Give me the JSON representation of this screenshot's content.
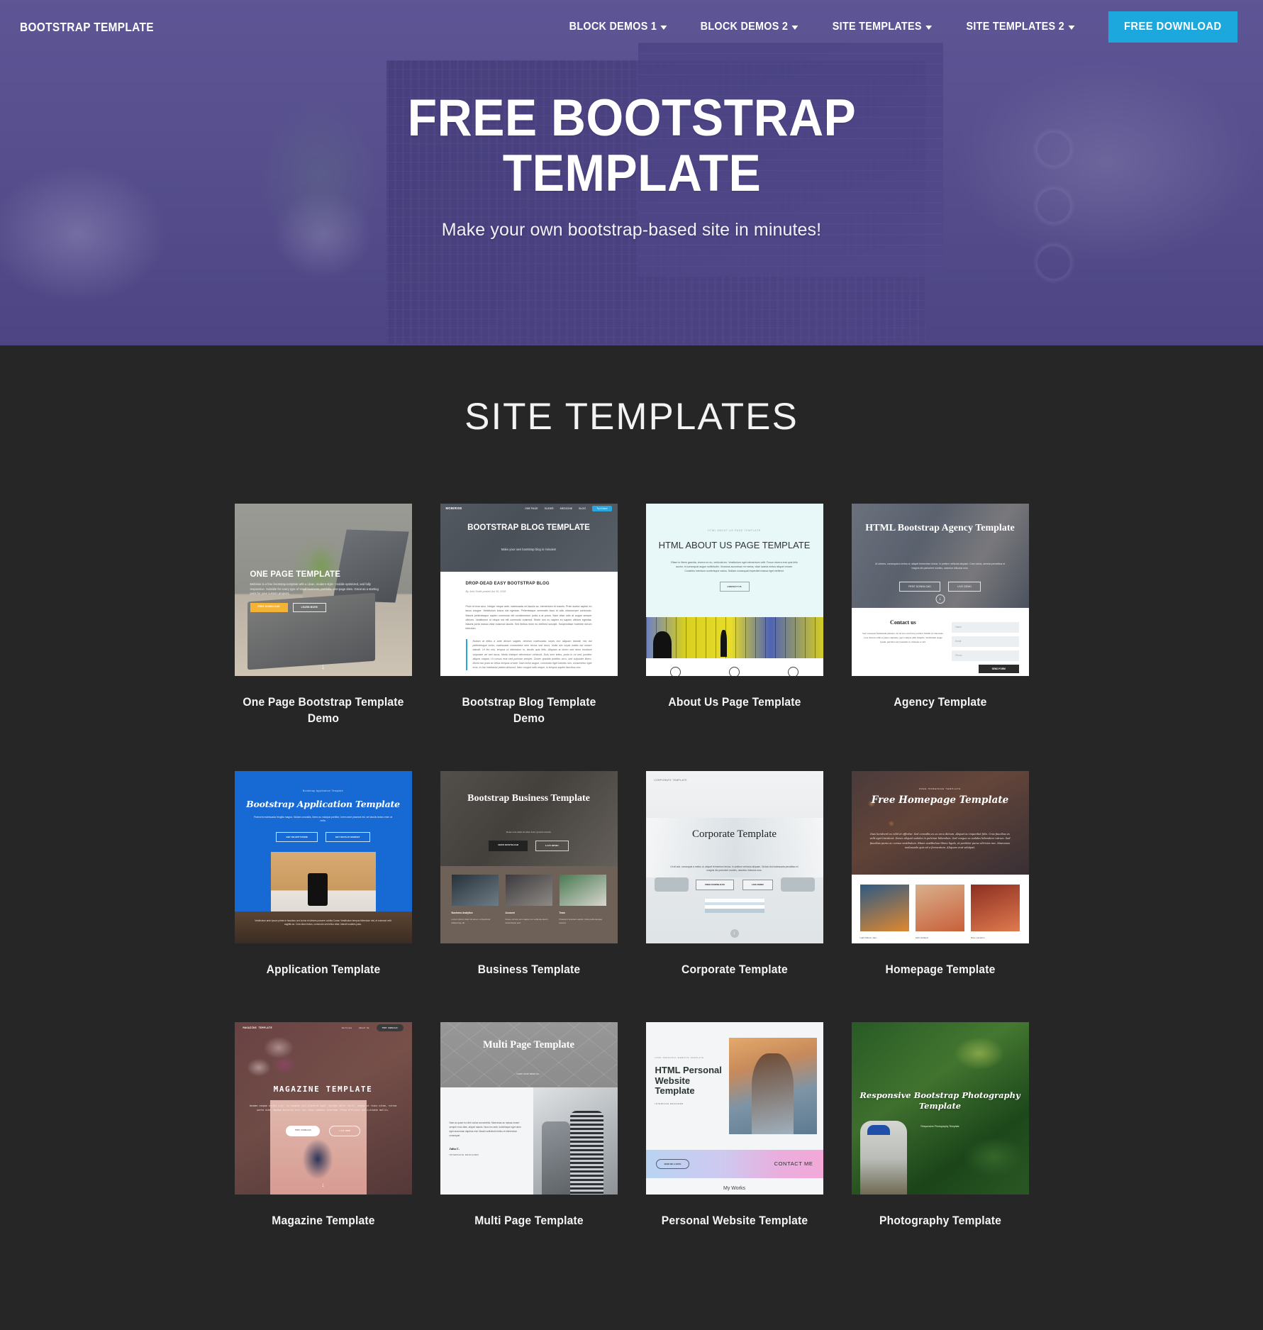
{
  "navbar": {
    "brand": "BOOTSTRAP TEMPLATE",
    "items": [
      {
        "label": "BLOCK DEMOS 1"
      },
      {
        "label": "BLOCK DEMOS 2"
      },
      {
        "label": "SITE TEMPLATES"
      },
      {
        "label": "SITE TEMPLATES 2"
      }
    ],
    "cta": "FREE DOWNLOAD",
    "cta_color": "#1ca8dd"
  },
  "hero": {
    "title": "FREE BOOTSTRAP TEMPLATE",
    "subtitle": "Make your own bootstrap-based site in minutes!",
    "overlay_color": "#564c98"
  },
  "section": {
    "title": "SITE TEMPLATES",
    "background": "#262626"
  },
  "cards": [
    {
      "caption": "One Page Bootstrap Template Demo",
      "preview": {
        "heading": "ONE PAGE TEMPLATE",
        "paragraph": "Mobirise is a free bootstrap template with a clean, modern style - mobile optimized, and fully responsive. Suitable for every type of small business, portfolio, one-page sites. Great as a starting point for your custom projects.",
        "button_primary": "FREE DOWNLOAD",
        "button_secondary": "LEARN MORE",
        "arrow": "↓"
      }
    },
    {
      "caption": "Bootstrap Blog Template Demo",
      "preview": {
        "logo": "MOBIRISE",
        "links": [
          "ONE PAGE",
          "SLIDER",
          "MEDICINE",
          "BLOG"
        ],
        "pill": "Try It Now!",
        "heading": "BOOTSTRAP BLOG TEMPLATE",
        "subheading": "Make your own bootstrap blog in minutes!",
        "article_title": "DROP-DEAD EASY BOOTSTRAP BLOG",
        "article_meta": "By John Smith posted Jun 30, 2018",
        "article_body": "Proin id eros arcu. Integer neque ante, malesuada vel iaculis ac, elementum et mauris. Proin auctor sapien eu lacus congue. Vestibulum luctus nisl egestas. Pellentesque venenatis risus id odio ullamcorper commodo. Mauris pellentesque sapien commodo elit condimentum porta a at purus. Nam vitae odio at augue semper ultrices. Vestibulum id neque est elit commodo euismod. Morbi non eu sapien eu sapien ultrices egestas. Mauris porta massa vitae euismod iaculis. Sed finibus enim eu eleifend suscipit. Suspendisse molestie rutrum interdum.",
        "article_quote": "Nullam at tellus a ante dictum sagittis. Aenean malesuada, turpis non aliquam blandit, nisi dui pellentesque tortor, malesuada consectetur sem lectus sed lacus. Nulla nec turpis mattis dui ornare blandit. Ut leo nisl, tempus ut bibendum in, iaculis quis felis. Aliquam at lorem sed dolor tincidunt vulputate vel sed lacus. Morbi tristique elementum vehicula. Duis sem tellus, porta in mi sed, porttitor aliquet magna. Ut cursus erat sed pulvinar semper. Donec gravida porttitor arcu, sed vulputate libero. Morbi non justo ac tellus tempus ornare. Nam tortor augue, commodo eget lobortis non, consectetur eget eros. In hac habitasse platea dictumst. Nam congue odio neque, in tempus sapien faucibus non."
      }
    },
    {
      "caption": "About Us Page Template",
      "preview": {
        "kicker": "HTML ABOUT US PAGE TEMPLATE",
        "heading": "HTML ABOUT US PAGE TEMPLATE",
        "paragraph": "Etiam in libero gravida, viverra ex eu, vehicula leo. Vestibulum eget elementum velit. Fusce viverra erat quis felis auctor, id consequat augue sollicitudin. Vivamus accumsan mi metus, vitae lacinia metus aliquet ornare. Curabitur interdum scelerisque varius. Nullam consequat imperdiet massa eget eleifend.",
        "button": "CONTACT US"
      }
    },
    {
      "caption": "Agency Template",
      "preview": {
        "heading": "HTML Bootstrap Agency Template",
        "paragraph": "Ut ultrices, consequat a metus ut, aliquet fermentum lectus. In pretium vehicula aliquam. Cras varius, aenean penatibus et magnis dis parturient montes, nascetur ridiculus mus.",
        "button_primary": "FREE DOWNLOAD",
        "button_secondary": "LIVE DEMO",
        "contact_heading": "Contact us",
        "contact_paragraph": "Sed consequat fermentum pharetra. In vel eros sed dolor porttitor blandit ut vitae nunc. Cras rhoncus nibh et purus vulputate, eget volutpat nibh fringilla. Vestibulum neque ipsum, pulvinar sed venenatis at, tristique ac dui.",
        "fields": [
          "Name",
          "Email",
          "Phone"
        ],
        "submit": "SEND FORM"
      }
    },
    {
      "caption": "Application Template",
      "preview": {
        "kicker": "Bootstrap Application Template",
        "heading": "Bootstrap Application Template",
        "paragraph": "Praesent malesuada fringilla magna. Nullam convallis, libero ac volutpat porttitor, lorem ante placerat est, vel iaculis lectus enim at nulla.",
        "button_primary": "GET ON APP STORE",
        "button_secondary": "GET ON PLAY MARKET",
        "footer_text": "Vestibulum ante ipsum primis in faucibus orci luctus et ultrices posuere cubilia Curae; Vestibulum tempus bibendum nisl, et euismod velit sagittis ac. Cras diam lectus, commodo sed tellus vitae, blandit sodales justo."
      }
    },
    {
      "caption": "Business Template",
      "preview": {
        "heading": "Bootstrap Business Template",
        "subheading": "Donec non diam sit amet dolor gravida rutrum.",
        "button_primary": "FREE DOWNLOAD",
        "button_secondary": "LIVE DEMO",
        "features": [
          {
            "title": "Business Analytics",
            "text": "Lorem ipsum dolor sit amet, consectetur adipiscing elit."
          },
          {
            "title": "Account",
            "text": "Fusce ornare sem sapien eu vehicula quam scelerisque sed."
          },
          {
            "title": "Team",
            "text": "Praesent tincidunt sapien vitae pellentesque laoreet."
          }
        ]
      }
    },
    {
      "caption": "Corporate Template",
      "preview": {
        "kicker": "CORPORATE TEMPLATE",
        "heading": "Corporate Template",
        "paragraph": "Ut sit sed, consequat a metus ut, aliquet fermentum lectus. In pretium vehicula aliquam. Dictum dui malesuada penatibus et magnis dis parturient montes, nascetur ridiculus mus.",
        "button_primary": "FREE DOWNLOAD",
        "button_secondary": "LIVE DEMO"
      }
    },
    {
      "caption": "Homepage Template",
      "preview": {
        "kicker": "FREE HOMEPAGE TEMPLATE",
        "heading": "Free Homepage Template",
        "paragraph": "Duis hendrerit ex nihil et efficitur. Sed convallis ex eu arcu dictum. Aliquet ac imperdiet felis. Cras faucibus ex velit eget tincidunt. Donec aliquet sodales in pulvinar bibendum. Sed congue ac sodales bibendum rutrum. Sed faucibus purus ac cursus vestibulum. Etiam vestibulum libero ligula, et porttitor purus ultricies nec. Maecenas malesuada quis sit a fermentum. Aliquam erat volutpat.",
        "thumbs": [
          "Light Mason Jars",
          "LED Garland",
          "Rare Lanterns"
        ]
      }
    },
    {
      "caption": "Magazine Template",
      "preview": {
        "logo": "MAGAZINE TEMPLATE",
        "links": [
          "Services",
          "About Us"
        ],
        "pill": "FREE DOWNLOAD",
        "heading": "MAGAZINE  TEMPLATE",
        "paragraph": "Aenean congue varius nisi, eu commodo nisl placerat eget. Integer dolor velit, tempus ut risus vitae, rutrum porta nibh. Aenean molestie orci nec risus sodales interdum. Proin efficitur sollicitudin mollis.",
        "button_primary": "FREE DOWNLOAD",
        "button_secondary": "LIVE DEMO",
        "arrow": "↓"
      }
    },
    {
      "caption": "Multi Page Template",
      "preview": {
        "heading": "Multi Page Template",
        "subheading": "Learn more about us...",
        "paragraph": "Nam ac quam eu nibh varius consectetur. Maecenas ac massa ornare semper eros vitae, aliquet mauris. Nunc leo ante, scelerisque eget dolor eget accumsan dapibus erat. Mauris sollicitudin tellus ut elementum consequat.",
        "person_name": "Julia C.",
        "person_role": "INTERFACE DESIGNER"
      }
    },
    {
      "caption": "Personal Website Template",
      "preview": {
        "kicker": "HTML PERSONAL WEBSITE TEMPLATE",
        "heading": "HTML Personal Website Template",
        "role": "INTERFACE DESIGNER",
        "button": "SEND ME A NOTE",
        "cta": "CONTACT ME",
        "works_heading": "My Works"
      }
    },
    {
      "caption": "Photography Template",
      "preview": {
        "heading": "Responsive Bootstrap Photography Template",
        "subheading": "Responsive Photography Template"
      }
    }
  ]
}
